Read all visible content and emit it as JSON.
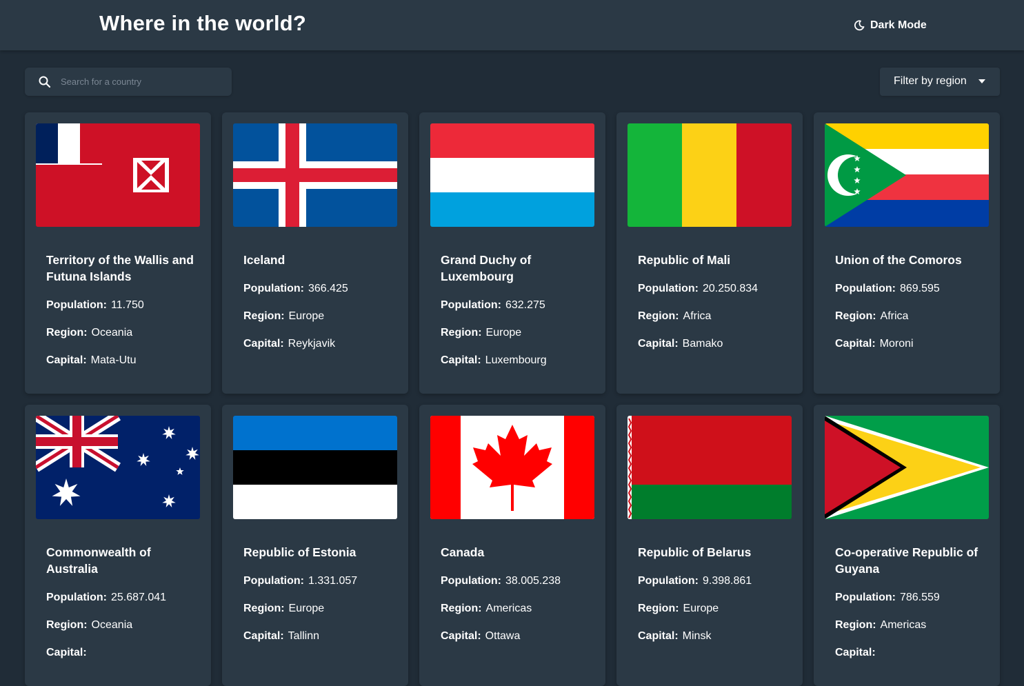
{
  "header": {
    "title": "Where in the world?",
    "mode_label": "Dark Mode"
  },
  "search": {
    "placeholder": "Search for a country",
    "value": ""
  },
  "filter": {
    "label": "Filter by region"
  },
  "labels": {
    "population": "Population:",
    "region": "Region:",
    "capital": "Capital:"
  },
  "countries": [
    {
      "name": "Territory of the Wallis and Futuna Islands",
      "population": "11.750",
      "region": "Oceania",
      "capital": "Mata-Utu",
      "flag": "wallis-futuna-flag"
    },
    {
      "name": "Iceland",
      "population": "366.425",
      "region": "Europe",
      "capital": "Reykjavik",
      "flag": "iceland-flag"
    },
    {
      "name": "Grand Duchy of Luxembourg",
      "population": "632.275",
      "region": "Europe",
      "capital": "Luxembourg",
      "flag": "luxembourg-flag"
    },
    {
      "name": "Republic of Mali",
      "population": "20.250.834",
      "region": "Africa",
      "capital": "Bamako",
      "flag": "mali-flag"
    },
    {
      "name": "Union of the Comoros",
      "population": "869.595",
      "region": "Africa",
      "capital": "Moroni",
      "flag": "comoros-flag"
    },
    {
      "name": "Commonwealth of Australia",
      "population": "25.687.041",
      "region": "Oceania",
      "capital": "",
      "flag": "australia-flag"
    },
    {
      "name": "Republic of Estonia",
      "population": "1.331.057",
      "region": "Europe",
      "capital": "Tallinn",
      "flag": "estonia-flag"
    },
    {
      "name": "Canada",
      "population": "38.005.238",
      "region": "Americas",
      "capital": "Ottawa",
      "flag": "canada-flag"
    },
    {
      "name": "Republic of Belarus",
      "population": "9.398.861",
      "region": "Europe",
      "capital": "Minsk",
      "flag": "belarus-flag"
    },
    {
      "name": "Co-operative Republic of Guyana",
      "population": "786.559",
      "region": "Americas",
      "capital": "",
      "flag": "guyana-flag"
    }
  ],
  "colors": {
    "background": "#202c37",
    "surface": "#2b3945",
    "text": "#ffffff",
    "placeholder": "#7b8794"
  }
}
